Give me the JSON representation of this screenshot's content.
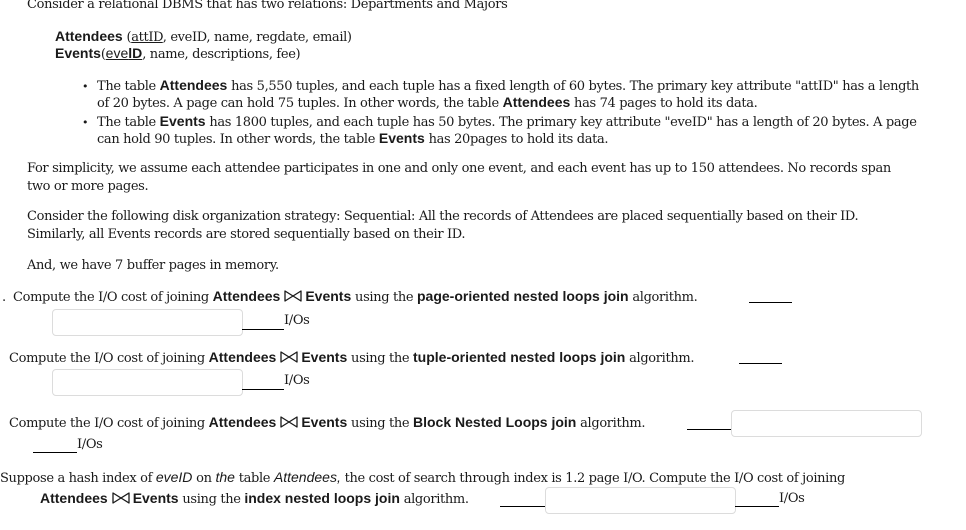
{
  "intro": "Consider a relational DBMS that has two relations: Departments and Majors",
  "schema": {
    "attendees": {
      "name": "Attendees",
      "open": " (",
      "key": "attID",
      "rest": ", eveID, name, regdate, email)"
    },
    "events": {
      "name": "Events",
      "open": "(",
      "key_plain": "eve",
      "key_bold": "lD",
      "rest": ", name, descriptions, fee)"
    }
  },
  "bullets": [
    {
      "line1_a": "The table ",
      "line1_b": "Attendees",
      "line1_c": " has 5,550 tuples, and each tuple has a fixed length of 60 bytes. The primary key attribute \"attID\" has a length",
      "line2_a": "of 20 bytes.  A page can hold 75 tuples.  In other words, the table ",
      "line2_b": "Attendees",
      "line2_c": " has 74 pages to hold its data."
    },
    {
      "line1_a": "The table ",
      "line1_b": "Events",
      "line1_c": " has 1800 tuples, and each tuple has 50 bytes. The primary key attribute \"eveID\" has a length of 20 bytes.  A page",
      "line2_a": "can hold 90 tuples.  In other words, the table ",
      "line2_b": "Events",
      "line2_c": " has 20pages to hold its data."
    }
  ],
  "paragraphs": {
    "simplicity_1": "For simplicity, we assume each attendee participates in one and only one event, and each event has up to  150 attendees. No records span",
    "simplicity_2": "two or more pages.",
    "strategy_1": "Consider the following disk organization strategy: Sequential: All the records of Attendees are placed sequentially based on their ID.",
    "strategy_2": "Similarly, all Events records are stored sequentially based on their ID.",
    "buffer": "And, we have 7 buffer pages in memory."
  },
  "questions": [
    {
      "number_mark": ".",
      "prefix": "Compute the I/O cost of joining ",
      "rel1": "Attendees",
      "rel2": "Events",
      "middle": " using the ",
      "algorithm": "page-oriented nested loops join",
      "suffix": " algorithm.",
      "unit": "I/Os",
      "answer_value": ""
    },
    {
      "prefix": "Compute the I/O cost of joining ",
      "rel1": "Attendees",
      "rel2": "Events",
      "middle": " using the ",
      "algorithm": "tuple-oriented nested loops join",
      "suffix": " algorithm.",
      "unit": "I/Os",
      "answer_value": ""
    },
    {
      "prefix": "Compute the I/O cost of joining ",
      "rel1": "Attendees",
      "rel2": "Events",
      "middle": " using the ",
      "algorithm": "Block Nested Loops join",
      "suffix": " algorithm.",
      "unit": "I/Os",
      "answer_value": ""
    },
    {
      "intro_a": "Suppose a hash index of ",
      "intro_b": "eveID",
      "intro_c": " on ",
      "intro_d": "the",
      "intro_e": " table ",
      "intro_f": "Attendees,",
      "intro_g": " the cost of search through index is 1.2 page I/O.   Compute the I/O cost of joining",
      "rel1": "Attendees",
      "rel2": "Events",
      "middle": " using the ",
      "algorithm": "index nested loops join",
      "suffix": " algorithm.",
      "unit": "I/Os",
      "answer_value": ""
    }
  ],
  "icons": {
    "join": "bowtie-join-icon"
  }
}
